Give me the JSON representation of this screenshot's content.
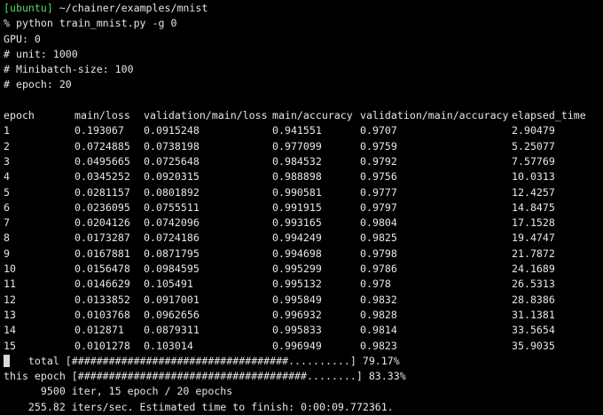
{
  "prompt": {
    "host": "[ubuntu]",
    "path": "~/chainer/examples/mnist"
  },
  "command": "% python train_mnist.py -g 0",
  "config_lines": [
    "GPU: 0",
    "# unit: 1000",
    "# Minibatch-size: 100",
    "# epoch: 20"
  ],
  "table": {
    "headers": [
      "epoch",
      "main/loss",
      "validation/main/loss",
      "main/accuracy",
      "validation/main/accuracy",
      "elapsed_time"
    ],
    "rows": [
      [
        "1",
        "0.193067",
        "0.0915248",
        "0.941551",
        "0.9707",
        "2.90479"
      ],
      [
        "2",
        "0.0724885",
        "0.0738198",
        "0.977099",
        "0.9759",
        "5.25077"
      ],
      [
        "3",
        "0.0495665",
        "0.0725648",
        "0.984532",
        "0.9792",
        "7.57769"
      ],
      [
        "4",
        "0.0345252",
        "0.0920315",
        "0.988898",
        "0.9756",
        "10.0313"
      ],
      [
        "5",
        "0.0281157",
        "0.0801892",
        "0.990581",
        "0.9777",
        "12.4257"
      ],
      [
        "6",
        "0.0236095",
        "0.0755511",
        "0.991915",
        "0.9797",
        "14.8475"
      ],
      [
        "7",
        "0.0204126",
        "0.0742096",
        "0.993165",
        "0.9804",
        "17.1528"
      ],
      [
        "8",
        "0.0173287",
        "0.0724186",
        "0.994249",
        "0.9825",
        "19.4747"
      ],
      [
        "9",
        "0.0167881",
        "0.0871795",
        "0.994698",
        "0.9798",
        "21.7872"
      ],
      [
        "10",
        "0.0156478",
        "0.0984595",
        "0.995299",
        "0.9786",
        "24.1689"
      ],
      [
        "11",
        "0.0146629",
        "0.105491",
        "0.995132",
        "0.978",
        "26.5313"
      ],
      [
        "12",
        "0.0133852",
        "0.0917001",
        "0.995849",
        "0.9832",
        "28.8386"
      ],
      [
        "13",
        "0.0103768",
        "0.0962656",
        "0.996932",
        "0.9828",
        "31.1381"
      ],
      [
        "14",
        "0.012871",
        "0.0879311",
        "0.995833",
        "0.9814",
        "33.5654"
      ],
      [
        "15",
        "0.0101278",
        "0.103014",
        "0.996949",
        "0.9823",
        "35.9035"
      ]
    ]
  },
  "progress": {
    "total_line": "    total [###################################..........] 79.17%",
    "epoch_line": "this epoch [#####################################........] 83.33%",
    "iter_line": "      9500 iter, 15 epoch / 20 epochs",
    "speed_line": "    255.82 iters/sec. Estimated time to finish: 0:00:09.772361."
  },
  "colors": {
    "background": "#000000",
    "text": "#e6e6e6",
    "prompt_host": "#5fd75f",
    "cursor": "#d9d9d9"
  }
}
